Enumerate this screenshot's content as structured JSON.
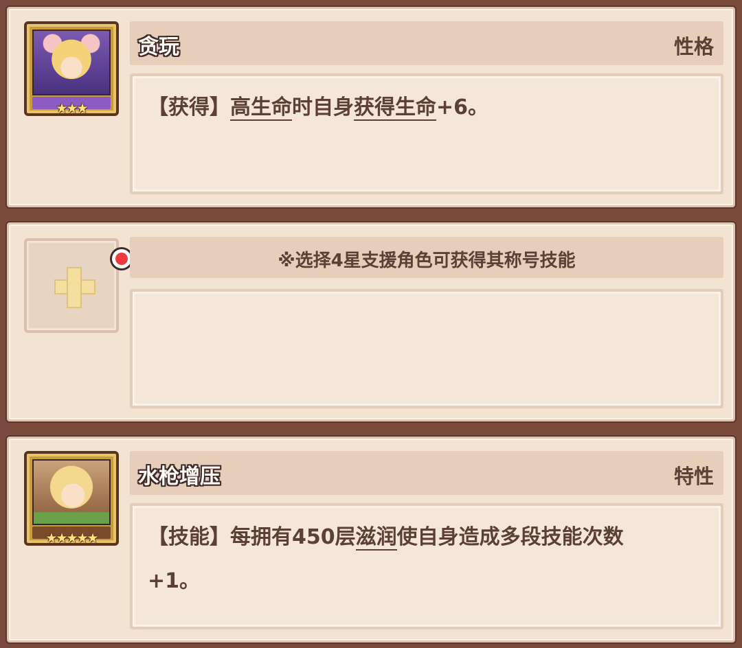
{
  "cards": [
    {
      "name": "贪玩",
      "tag": "性格",
      "stars": "★★★",
      "desc": {
        "p1": "【获得】",
        "u1": "高生命",
        "p2": "时自身",
        "u2": "获得生命",
        "p3": "+6。"
      }
    },
    {
      "hint": "※选择4星支援角色可获得其称号技能"
    },
    {
      "name": "水枪增压",
      "tag": "特性",
      "stars": "★★★★★",
      "desc": {
        "p1": "【技能】每拥有450层",
        "u1": "滋润",
        "p2": "使自身造成多段技能次数",
        "p3": "+1。"
      }
    }
  ],
  "colors": {
    "frame": "#7a4a3c",
    "card": "#f2e3d3",
    "text": "#5c3f35",
    "badge": "#ee3a3a"
  }
}
